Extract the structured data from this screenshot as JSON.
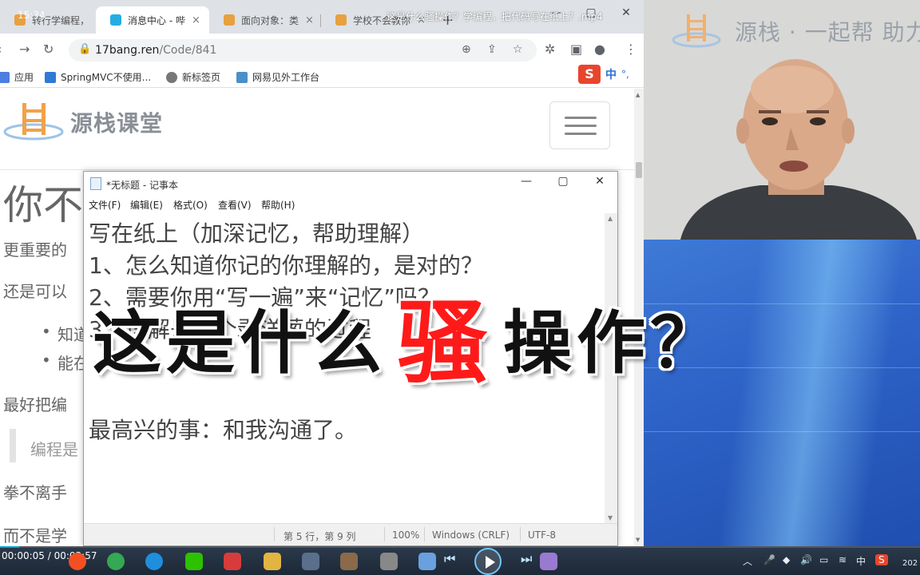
{
  "browser": {
    "clock": "15:34",
    "tabs": [
      {
        "title": "转行学编程，",
        "color": "#e8a040",
        "close": "×"
      },
      {
        "title": "消息中心 - 哔",
        "color": "#23ade5",
        "close": "×"
      },
      {
        "title": "面向对象：类",
        "color": "#e8a040",
        "close": "×"
      },
      {
        "title": "学校不会教你",
        "color": "#e8a040",
        "close": "×"
      }
    ],
    "new_tab": "+",
    "window_controls": {
      "minimize": "—",
      "maximize": "▢",
      "close": "✕"
    },
    "url_host": "17bang.ren",
    "url_path": "/Code/841",
    "bookmarks": [
      {
        "label": "应用",
        "color": "#4a7ee0"
      },
      {
        "label": "SpringMVC不使用...",
        "color": "#2f7ad6"
      },
      {
        "label": "新标签页",
        "color": "#777777"
      },
      {
        "label": "网易见外工作台",
        "color": "#4a90c8"
      }
    ],
    "ime": {
      "logo": "S",
      "lang": "中",
      "dots": "°,"
    }
  },
  "site": {
    "logo_text": "源栈课堂",
    "heading_partial": "你不",
    "paragraphs": [
      "更重要的",
      "还是可以",
      "知道",
      "能在",
      "最好把编",
      "编程是",
      "拳不离手",
      "而不是学"
    ]
  },
  "notepad": {
    "title": "*无标题 - 记事本",
    "menu": [
      "文件(F)",
      "编辑(E)",
      "格式(O)",
      "查看(V)",
      "帮助(H)"
    ],
    "lines": [
      "写在纸上（加深记忆，帮助理解）",
      "1、怎么知道你记的你理解的，是对的？",
      "2、需要你用“写一遍”来“记忆”吗？",
      "3、理解是一个剥洋葱的过程",
      "",
      "最高兴的事：和我沟通了。"
    ],
    "status": {
      "position": "第 5 行，第 9 列",
      "zoom": "100%",
      "eol": "Windows (CRLF)",
      "encoding": "UTF-8"
    }
  },
  "webcam": {
    "watermark": "源栈 · 一起帮 助力"
  },
  "overlay": {
    "top_subtitle": "这是什么骚操作？学编程，把代码写在纸上？.mp4",
    "caption_before": "这是什么",
    "caption_highlight": "骚",
    "caption_after": "操作？",
    "highlight_color": "#ff1a1a"
  },
  "player": {
    "current_time": "00:00:05",
    "total_time": "00:03:57",
    "progress": 0.021,
    "tray_lang": "中",
    "tray_year": "202"
  }
}
